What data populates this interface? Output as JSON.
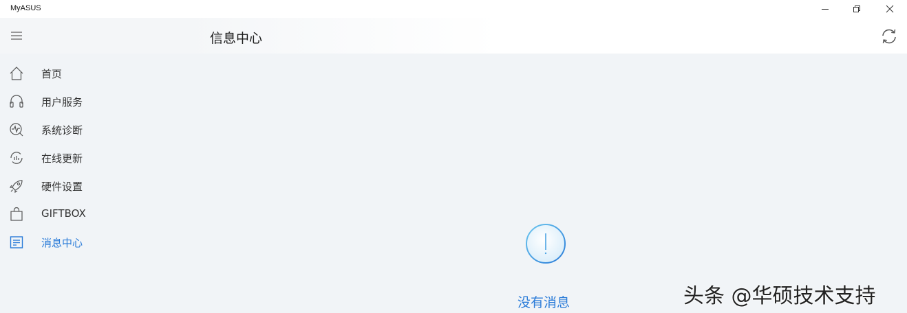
{
  "window": {
    "app_name": "MyASUS",
    "minimize_icon": "minimize-icon",
    "restore_icon": "restore-icon",
    "close_icon": "close-icon"
  },
  "header": {
    "title": "信息中心",
    "menu_icon": "hamburger-icon",
    "refresh_icon": "refresh-icon"
  },
  "sidebar": {
    "items": [
      {
        "label": "首页",
        "icon": "home-icon",
        "active": false
      },
      {
        "label": "用户服务",
        "icon": "headset-icon",
        "active": false
      },
      {
        "label": "系统诊断",
        "icon": "diagnosis-icon",
        "active": false
      },
      {
        "label": "在线更新",
        "icon": "update-icon",
        "active": false
      },
      {
        "label": "硬件设置",
        "icon": "rocket-icon",
        "active": false
      },
      {
        "label": "GIFTBOX",
        "icon": "bag-icon",
        "active": false
      },
      {
        "label": "消息中心",
        "icon": "message-icon",
        "active": true
      }
    ]
  },
  "main": {
    "empty_icon": "exclamation-icon",
    "empty_text": "没有消息"
  },
  "watermark": {
    "text": "头条 @华硕技术支持"
  },
  "colors": {
    "accent": "#2a7bd8",
    "background": "#f1f4f7",
    "icon_gray": "#555555"
  }
}
